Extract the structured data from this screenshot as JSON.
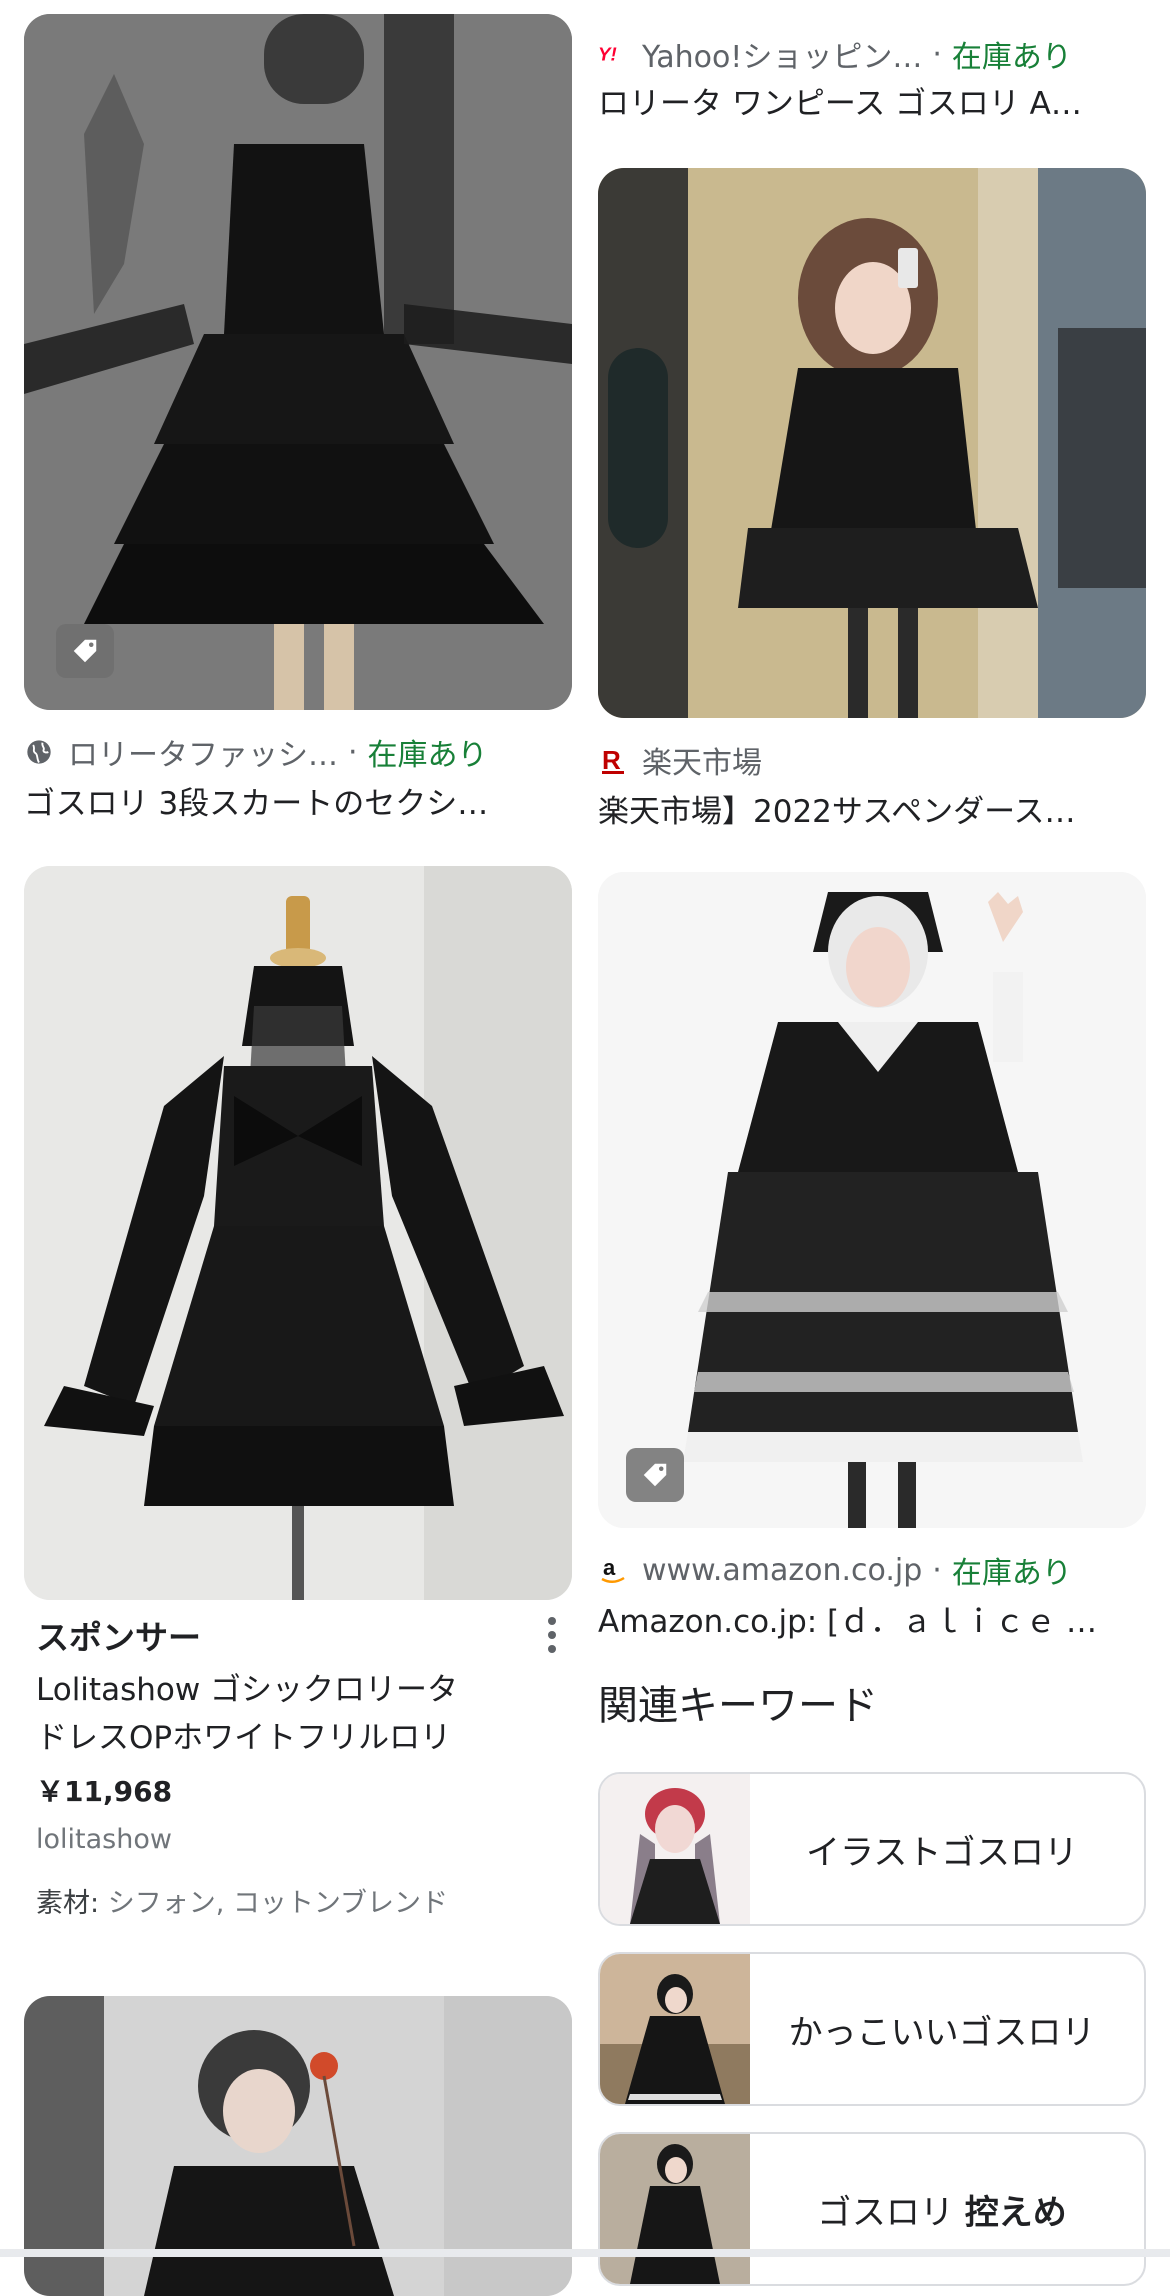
{
  "left_column": {
    "result1": {
      "source": "ロリータファッシ…",
      "stock": "在庫あり",
      "title": "ゴスロリ 3段スカートのセクシ…"
    },
    "sponsored": {
      "label": "スポンサー",
      "title_line1": "Lolitashow ゴシックロリータ",
      "title_line2": "ドレスOPホワイトフリルロリ",
      "price": "￥11,968",
      "merchant": "lolitashow",
      "material_label": "素材:",
      "material_value": "シフォン, コットンブレンド"
    }
  },
  "right_column": {
    "result1": {
      "source": "Yahoo!ショッピン…",
      "stock": "在庫あり",
      "title": "ロリータ ワンピース ゴスロリ A…"
    },
    "result2": {
      "source": "楽天市場",
      "title": "楽天市場】2022サスペンダース…"
    },
    "result3": {
      "source": "www.amazon.co.jp",
      "stock": "在庫あり",
      "title": "Amazon.co.jp: [ｄ．ａｌｉｃｅ …"
    },
    "related": {
      "heading": "関連キーワード",
      "items": [
        {
          "label": "イラストゴスロリ"
        },
        {
          "label": "かっこいいゴスロリ"
        },
        {
          "label_plain": "ゴスロリ",
          "label_bold": "控えめ"
        }
      ]
    }
  },
  "colors": {
    "stock_green": "#188038",
    "secondary_text": "#5f6368",
    "rakuten_red": "#bf0000",
    "yahoo_red": "#ff0033",
    "amazon_orange": "#ff9900"
  },
  "icons": [
    "globe-icon",
    "yahoo-icon",
    "rakuten-icon",
    "amazon-icon",
    "tag-icon",
    "more-vert-icon"
  ]
}
